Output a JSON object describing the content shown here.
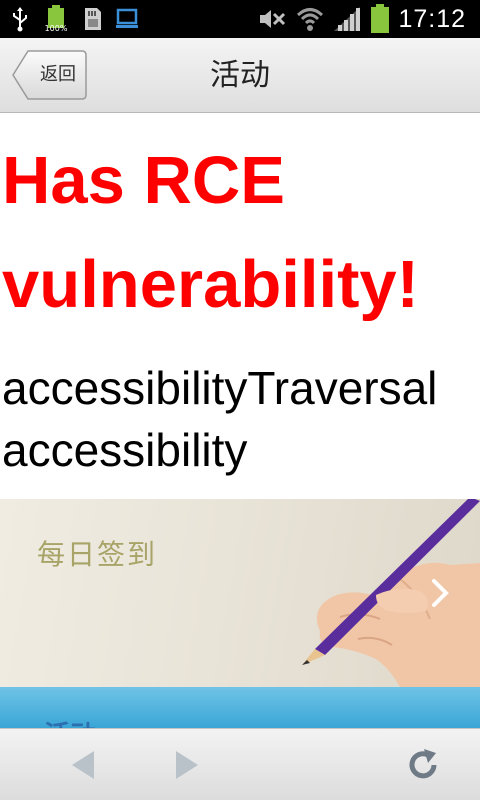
{
  "status_bar": {
    "time": "17:12",
    "battery_small_label": "100%",
    "icons": [
      "usb-icon",
      "battery-full-icon",
      "sd-card-icon",
      "monitor-icon",
      "mute-icon",
      "wifi-icon",
      "signal-icon",
      "battery-icon"
    ]
  },
  "titlebar": {
    "back_label": "返回",
    "title": "活动"
  },
  "content": {
    "headline": [
      "Has RCE",
      "vulnerability!"
    ],
    "subtext": [
      "accessibilityTraversal",
      "accessibility"
    ],
    "banner": {
      "text": "每日签到",
      "next_icon": "chevron-right-icon"
    },
    "banner2": {
      "text": "活动"
    }
  },
  "toolbar": {
    "icons": [
      "nav-back-icon",
      "nav-forward-icon",
      "refresh-icon"
    ]
  },
  "colors": {
    "headline": "#ff0000",
    "banner_text": "#a8a468",
    "pencil": "#5a2d9c"
  }
}
